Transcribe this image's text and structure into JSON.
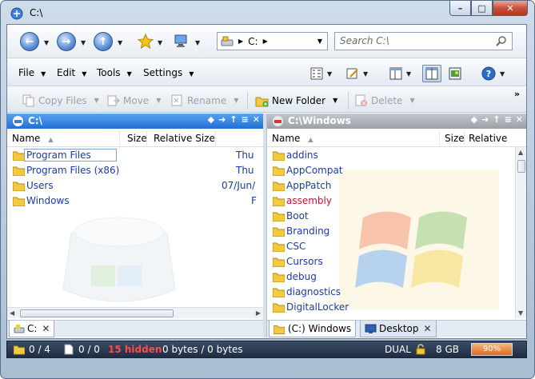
{
  "window": {
    "title": "C:\\"
  },
  "nav": {
    "address_segments": [
      "C:"
    ],
    "search_placeholder": "Search C:\\"
  },
  "menu": {
    "items": [
      "File",
      "Edit",
      "Tools",
      "Settings"
    ]
  },
  "commands": {
    "copy_files": "Copy Files",
    "move": "Move",
    "rename": "Rename",
    "new_folder": "New Folder",
    "delete": "Delete"
  },
  "left_pane": {
    "path": "C:\\",
    "columns": [
      "Name",
      "Size",
      "Relative Size"
    ],
    "rows": [
      {
        "name": "Program Files",
        "date": "Thu"
      },
      {
        "name": "Program Files (x86)",
        "date": "Thu"
      },
      {
        "name": "Users",
        "date": "07/Jun/"
      },
      {
        "name": "Windows",
        "date": "F"
      }
    ],
    "tabs": [
      {
        "label": "C:"
      }
    ]
  },
  "right_pane": {
    "path": "C:\\Windows",
    "columns": [
      "Name",
      "Size",
      "Relative"
    ],
    "rows": [
      {
        "name": "addins",
        "compressed": false
      },
      {
        "name": "AppCompat",
        "compressed": false
      },
      {
        "name": "AppPatch",
        "compressed": false
      },
      {
        "name": "assembly",
        "compressed": true
      },
      {
        "name": "Boot",
        "compressed": false
      },
      {
        "name": "Branding",
        "compressed": false
      },
      {
        "name": "CSC",
        "compressed": false
      },
      {
        "name": "Cursors",
        "compressed": false
      },
      {
        "name": "debug",
        "compressed": false
      },
      {
        "name": "diagnostics",
        "compressed": false
      },
      {
        "name": "DigitalLocker",
        "compressed": false
      }
    ],
    "tabs": [
      {
        "label": "(C:) Windows"
      },
      {
        "label": "Desktop"
      }
    ]
  },
  "status": {
    "folders": "0 / 4",
    "files": "0 / 0",
    "hidden": "15 hidden",
    "bytes": "0 bytes / 0 bytes",
    "mode": "DUAL",
    "memory": "8 GB",
    "memory_percent": "90%"
  },
  "colors": {
    "active_pane_header": "#1f6fd6",
    "inactive_pane_header": "#9aa0a8",
    "link_text": "#1a3aa8",
    "compressed_text": "#c8102e",
    "hidden_count": "#ff4a4a",
    "memory_meter": "#e06a21"
  },
  "icons": [
    "app-icon",
    "back-icon",
    "forward-icon",
    "up-icon",
    "favorites-star-icon",
    "computer-icon",
    "drive-icon",
    "search-icon",
    "view-icon",
    "edit-icon",
    "single-pane-icon",
    "dual-pane-icon",
    "preview-icon",
    "help-icon",
    "folder-icon",
    "lock-icon"
  ]
}
